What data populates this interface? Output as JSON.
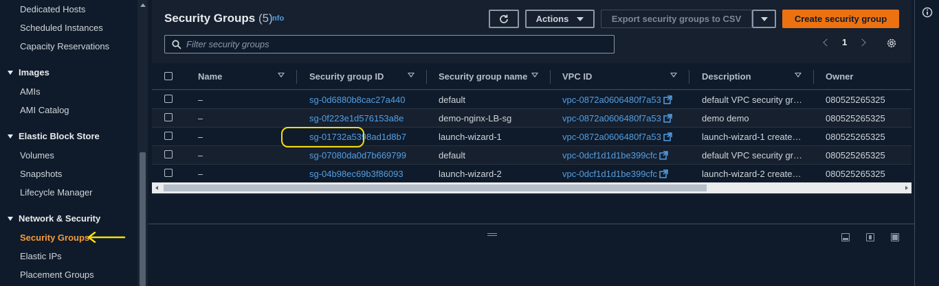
{
  "sidebar": {
    "items": [
      {
        "label": "Dedicated Hosts"
      },
      {
        "label": "Scheduled Instances"
      },
      {
        "label": "Capacity Reservations"
      }
    ],
    "sections": [
      {
        "label": "Images",
        "items": [
          {
            "label": "AMIs"
          },
          {
            "label": "AMI Catalog"
          }
        ]
      },
      {
        "label": "Elastic Block Store",
        "items": [
          {
            "label": "Volumes"
          },
          {
            "label": "Snapshots"
          },
          {
            "label": "Lifecycle Manager"
          }
        ]
      },
      {
        "label": "Network & Security",
        "items": [
          {
            "label": "Security Groups",
            "active": true
          },
          {
            "label": "Elastic IPs"
          },
          {
            "label": "Placement Groups"
          }
        ]
      }
    ]
  },
  "header": {
    "title": "Security Groups",
    "count": "(5)",
    "info": "Info"
  },
  "toolbar": {
    "actions_label": "Actions",
    "export_label": "Export security groups to CSV",
    "create_label": "Create security group"
  },
  "search": {
    "placeholder": "Filter security groups"
  },
  "pagination": {
    "current_page": "1"
  },
  "table": {
    "columns": [
      "Name",
      "Security group ID",
      "Security group name",
      "VPC ID",
      "Description",
      "Owner"
    ],
    "rows": [
      {
        "name": "–",
        "id": "sg-0d6880b8cac27a440",
        "group_name": "default",
        "vpc": "vpc-0872a0606480f7a53",
        "description": "default VPC security gr…",
        "owner": "080525265325"
      },
      {
        "name": "–",
        "id": "sg-0f223e1d576153a8e",
        "group_name": "demo-nginx-LB-sg",
        "vpc": "vpc-0872a0606480f7a53",
        "description": "demo demo",
        "owner": "080525265325"
      },
      {
        "name": "–",
        "id": "sg-01732a5398ad1d8b7",
        "group_name": "launch-wizard-1",
        "vpc": "vpc-0872a0606480f7a53",
        "description": "launch-wizard-1 create…",
        "owner": "080525265325"
      },
      {
        "name": "–",
        "id": "sg-07080da0d7b669799",
        "group_name": "default",
        "vpc": "vpc-0dcf1d1d1be399cfc",
        "description": "default VPC security gr…",
        "owner": "080525265325"
      },
      {
        "name": "–",
        "id": "sg-04b98ec69b3f86093",
        "group_name": "launch-wizard-2",
        "vpc": "vpc-0dcf1d1d1be399cfc",
        "description": "launch-wizard-2 create…",
        "owner": "080525265325"
      }
    ]
  },
  "colors": {
    "accent": "#ec7211",
    "link": "#539fe5",
    "active_nav": "#f89b3c",
    "annotation": "#f5dd0a"
  }
}
